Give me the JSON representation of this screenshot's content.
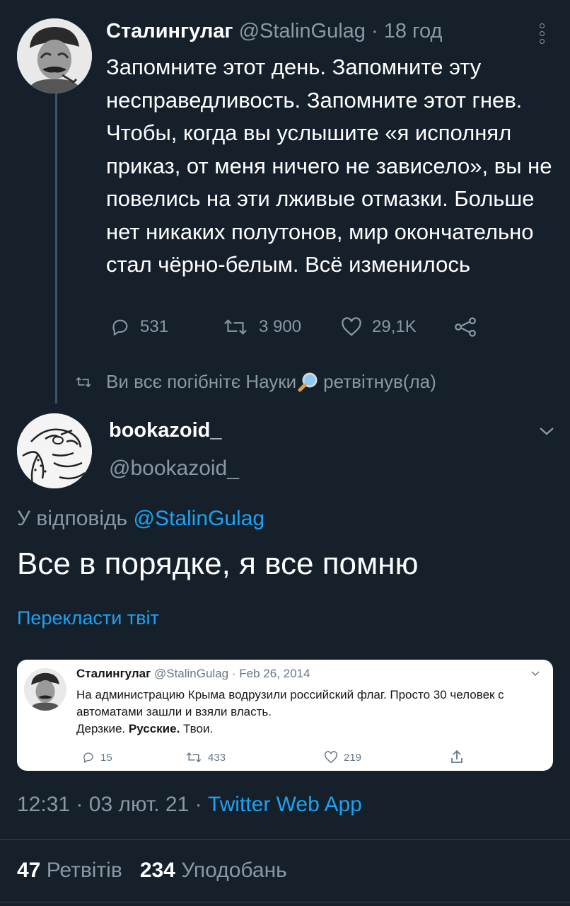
{
  "parent_tweet": {
    "display_name": "Сталингулаг",
    "handle": "@StalinGulag",
    "age": "18 год",
    "text": "Запомните этот день. Запомните эту несправедливость. Запомните этот гнев. Чтобы, когда вы услышите «я исполнял приказ, от меня ничего не зависело», вы не повелись на эти лживые отмазки. Больше нет никаких полутонов, мир окончательно стал чёрно-белым. Всё изменилось",
    "replies": "531",
    "retweets": "3 900",
    "likes": "29,1K"
  },
  "retweet_notice": {
    "user": "Ви всє погібнітє Науки",
    "suffix": "ретвітнув(ла)"
  },
  "main_tweet": {
    "display_name": "bookazoid_",
    "handle": "@bookazoid_",
    "reply_prefix": "У відповідь",
    "reply_to": "@StalinGulag",
    "text": "Все в порядке, я все помню",
    "translate_label": "Перекласти твіт"
  },
  "embedded": {
    "display_name": "Сталингулаг",
    "handle": "@StalinGulag",
    "date": "Feb 26, 2014",
    "line1": "На администрацию Крыма водрузили российский флаг. Просто 30 человек с автоматами зашли и взяли власть.",
    "line2_a": "Дерзкие.",
    "line2_b": "Русские.",
    "line2_c": "Твои.",
    "replies": "15",
    "retweets": "433",
    "likes": "219"
  },
  "footer": {
    "time": "12:31",
    "date": "03 лют. 21",
    "source": "Twitter Web App",
    "retweet_count": "47",
    "retweet_label": "Ретвітів",
    "like_count": "234",
    "like_label": "Уподобань"
  },
  "colors": {
    "background": "#15202b",
    "muted": "#8899a6",
    "link": "#1da1f2"
  },
  "icons": [
    "reply-icon",
    "retweet-icon",
    "like-icon",
    "share-icon",
    "kebab-icon",
    "chevron-down-icon",
    "magnifier-icon"
  ]
}
